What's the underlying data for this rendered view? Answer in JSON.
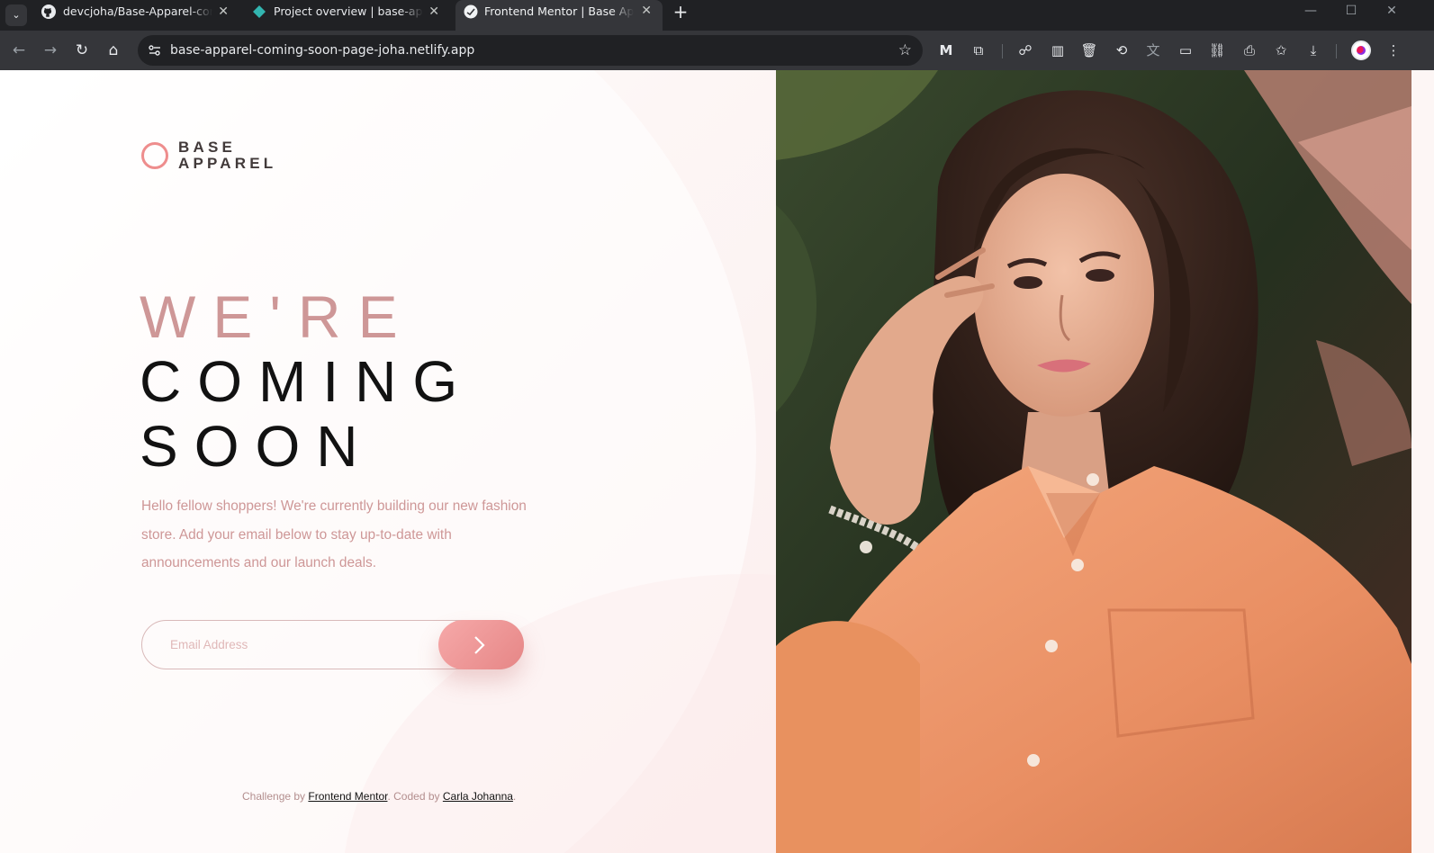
{
  "browser": {
    "tabs": [
      {
        "title": "devcjoha/Base-Apparel-coming-soon-page"
      },
      {
        "title": "Project overview | base-apparel-coming"
      },
      {
        "title": "Frontend Mentor | Base Apparel coming"
      }
    ],
    "address": "base-apparel-coming-soon-page-joha.netlify.app",
    "controls": {
      "minimize": "—",
      "maximize": "☐",
      "close": "✕"
    }
  },
  "page": {
    "logo": {
      "line1": "BASE",
      "line2": "APPAREL"
    },
    "headline": {
      "light": "WE'RE",
      "dark1": "COMING",
      "dark2": "SOON"
    },
    "intro": "Hello fellow shoppers! We're currently building our new fashion store. Add your email below to stay up-to-date with announcements and our launch deals.",
    "email": {
      "placeholder": "Email Address",
      "value": ""
    },
    "footer": {
      "prefix": "Challenge by",
      "link1": "Frontend Mentor",
      "middle": ". Coded by",
      "link2": "Carla Johanna",
      "suffix": "."
    },
    "colors": {
      "accent": "#ee8d8d",
      "text_rose": "#ce9797",
      "dark": "#423a3a"
    }
  }
}
